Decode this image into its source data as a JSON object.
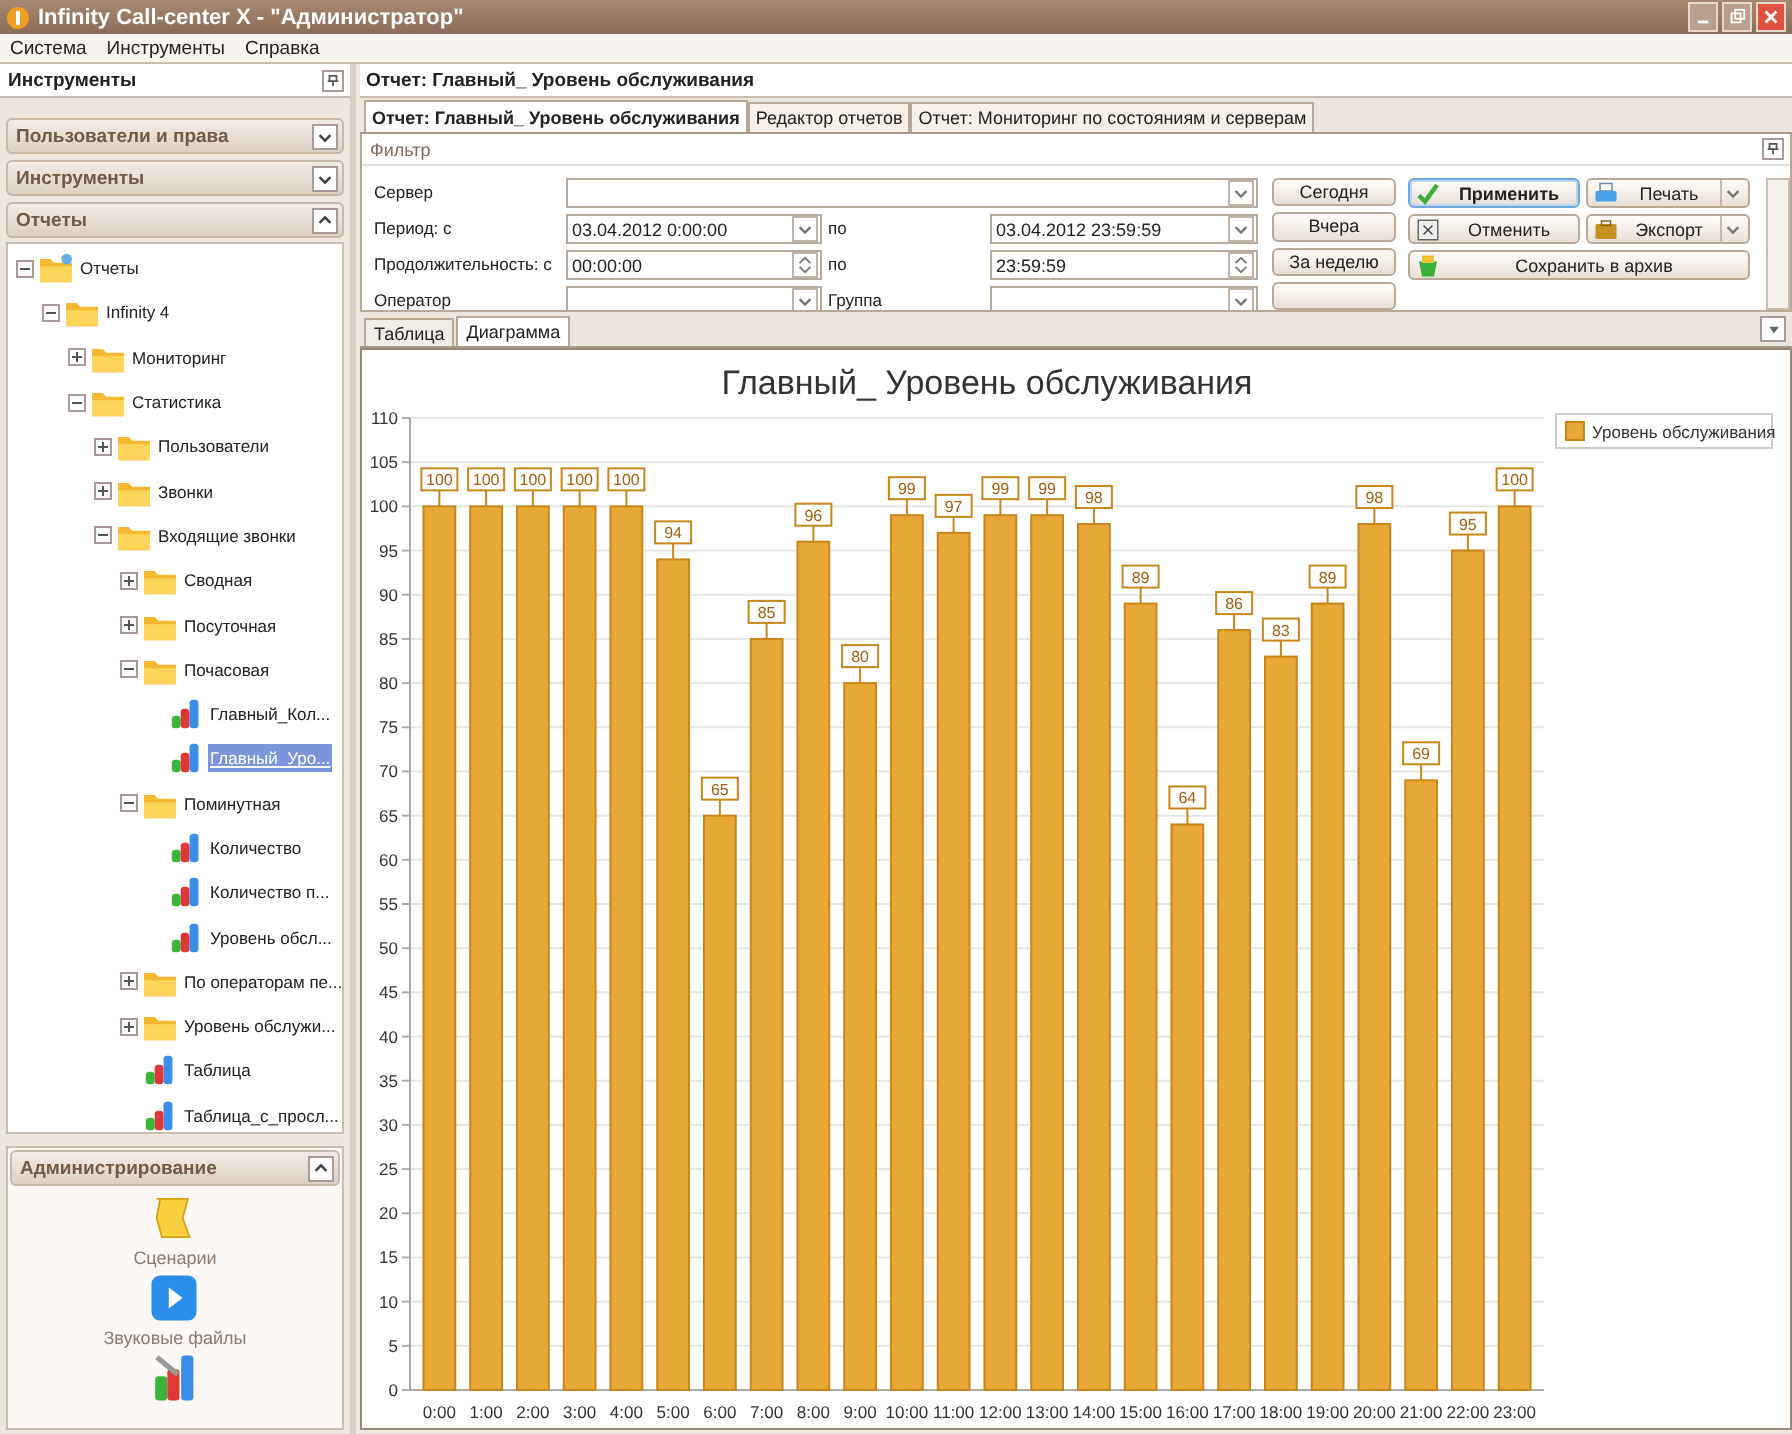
{
  "window": {
    "title": "Infinity Call-center X - \"Администратор\""
  },
  "menu": [
    "Система",
    "Инструменты",
    "Справка"
  ],
  "left_panel": {
    "title": "Инструменты",
    "sections": [
      {
        "title": "Пользователи и права",
        "expanded": false
      },
      {
        "title": "Инструменты",
        "expanded": false
      },
      {
        "title": "Отчеты",
        "expanded": true
      }
    ],
    "tree": [
      {
        "label": "Отчеты",
        "kind": "root",
        "expanded": true,
        "selected": false,
        "children": [
          {
            "label": "Infinity 4",
            "kind": "folder",
            "expanded": true,
            "selected": false,
            "children": [
              {
                "label": "Мониторинг",
                "kind": "folder",
                "expanded": false,
                "selected": false
              },
              {
                "label": "Статистика",
                "kind": "folder",
                "expanded": true,
                "selected": false,
                "children": [
                  {
                    "label": "Пользователи",
                    "kind": "folder",
                    "expanded": false,
                    "selected": false
                  },
                  {
                    "label": "Звонки",
                    "kind": "folder",
                    "expanded": false,
                    "selected": false
                  },
                  {
                    "label": "Входящие звонки",
                    "kind": "folder",
                    "expanded": true,
                    "selected": false,
                    "children": [
                      {
                        "label": "Сводная",
                        "kind": "folder",
                        "expanded": false,
                        "selected": false
                      },
                      {
                        "label": "Посуточная",
                        "kind": "folder",
                        "expanded": false,
                        "selected": false
                      },
                      {
                        "label": "Почасовая",
                        "kind": "folder",
                        "expanded": true,
                        "selected": false,
                        "children": [
                          {
                            "label": "Главный_Кол...",
                            "kind": "report",
                            "selected": false
                          },
                          {
                            "label": "Главный_Уро...",
                            "kind": "report",
                            "selected": true
                          }
                        ]
                      },
                      {
                        "label": "Поминутная",
                        "kind": "folder",
                        "expanded": true,
                        "selected": false,
                        "children": [
                          {
                            "label": "Количество",
                            "kind": "report",
                            "selected": false
                          },
                          {
                            "label": "Количество п...",
                            "kind": "report",
                            "selected": false
                          },
                          {
                            "label": "Уровень обсл...",
                            "kind": "report",
                            "selected": false
                          }
                        ]
                      },
                      {
                        "label": "По операторам пе...",
                        "kind": "folder",
                        "expanded": false,
                        "selected": false
                      },
                      {
                        "label": "Уровень обслужи...",
                        "kind": "folder",
                        "expanded": false,
                        "selected": false
                      },
                      {
                        "label": "Таблица",
                        "kind": "report",
                        "selected": false
                      },
                      {
                        "label": "Таблица_с_просл...",
                        "kind": "report",
                        "selected": false
                      }
                    ]
                  }
                ]
              }
            ]
          }
        ]
      }
    ],
    "admin": {
      "title": "Администрирование",
      "expanded": true,
      "items": [
        {
          "label": "Сценарии",
          "kind": "scroll"
        },
        {
          "label": "Звуковые файлы",
          "kind": "play"
        },
        {
          "kind": "tools"
        }
      ]
    }
  },
  "report_title": "Отчет: Главный_ Уровень обслуживания",
  "tabs": [
    {
      "label": "Отчет: Главный_ Уровень обслуживания",
      "selected": true
    },
    {
      "label": "Редактор отчетов",
      "selected": false
    },
    {
      "label": "Отчет: Мониторинг по состояниям и серверам",
      "selected": false
    }
  ],
  "filter": {
    "title": "Фильтр",
    "rows": [
      {
        "label": "Сервер",
        "kind": "combo-wide"
      },
      {
        "label": "Период: с",
        "kind": "combo",
        "value": "03.04.2012 0:00:00",
        "to_label": "по",
        "to_value": "03.04.2012 23:59:59"
      },
      {
        "label": "Продолжительность: с",
        "kind": "spin",
        "value": "00:00:00",
        "to_label": "по",
        "to_value": "23:59:59"
      },
      {
        "label": "Оператор",
        "kind": "combo",
        "to_label": "Группа"
      }
    ],
    "period_buttons": [
      "Сегодня",
      "Вчера",
      "За неделю"
    ],
    "actions": [
      {
        "label": "Применить",
        "kind": "apply",
        "focused": true
      },
      {
        "label": "Печать",
        "kind": "print"
      },
      {
        "label": "Отменить",
        "kind": "cancel",
        "focused": false
      },
      {
        "label": "Экспорт",
        "kind": "export"
      },
      {
        "label": "Сохранить в архив",
        "kind": "archive"
      }
    ]
  },
  "view_tabs": [
    {
      "label": "Таблица",
      "selected": false
    },
    {
      "label": "Диаграмма",
      "selected": true
    }
  ],
  "chart_data": {
    "type": "bar",
    "title": "Главный_ Уровень обслуживания",
    "categories": [
      "0:00",
      "1:00",
      "2:00",
      "3:00",
      "4:00",
      "5:00",
      "6:00",
      "7:00",
      "8:00",
      "9:00",
      "10:00",
      "11:00",
      "12:00",
      "13:00",
      "14:00",
      "15:00",
      "16:00",
      "17:00",
      "18:00",
      "19:00",
      "20:00",
      "21:00",
      "22:00",
      "23:00"
    ],
    "series": [
      {
        "name": "Уровень обслуживания",
        "color": "#e8a838",
        "values": [
          100,
          100,
          100,
          100,
          100,
          94,
          65,
          85,
          96,
          80,
          99,
          97,
          99,
          99,
          98,
          89,
          64,
          86,
          83,
          89,
          98,
          69,
          95,
          100
        ]
      }
    ],
    "ylim": [
      0,
      110
    ],
    "grid": true,
    "yticks": [
      0,
      5,
      10,
      15,
      20,
      25,
      30,
      35,
      40,
      45,
      50,
      55,
      60,
      65,
      70,
      75,
      80,
      85,
      90,
      95,
      100,
      105,
      110
    ],
    "data_labels": true
  }
}
